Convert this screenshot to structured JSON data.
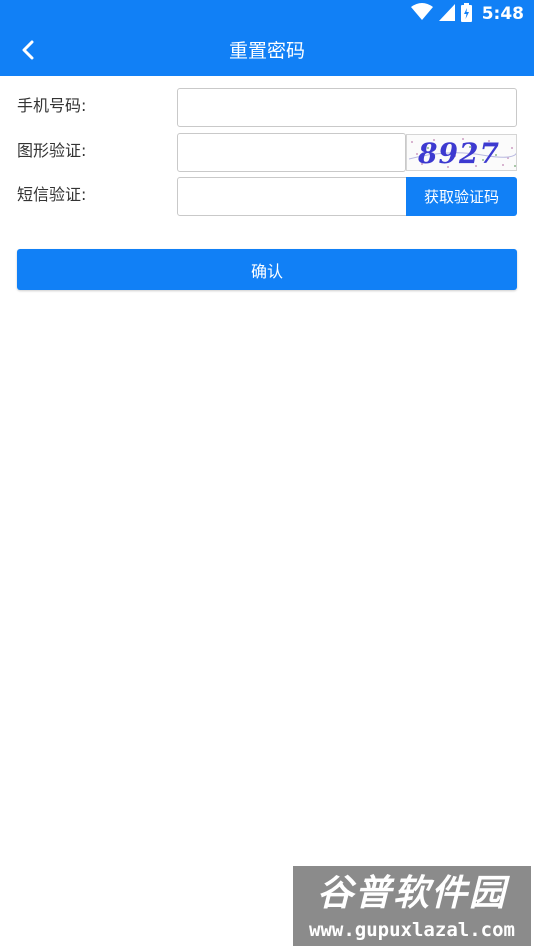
{
  "status_bar": {
    "time": "5:48",
    "icons": [
      "wifi-icon",
      "cell-signal-icon",
      "battery-icon"
    ]
  },
  "header": {
    "back_icon": "chevron-left-icon",
    "title": "重置密码"
  },
  "form": {
    "phone": {
      "label": "手机号码:",
      "value": ""
    },
    "captcha": {
      "label": "图形验证:",
      "value": "",
      "captcha_text": "8927"
    },
    "sms": {
      "label": "短信验证:",
      "value": "",
      "button_label": "获取验证码"
    }
  },
  "confirm_label": "确认",
  "watermark": {
    "text_top": "谷普软件园",
    "text_bottom": "www.gupuxlazal.com"
  },
  "colors": {
    "primary": "#1180f6",
    "background": "#ffffff",
    "label": "#333333",
    "input_border": "#c9c9c9"
  }
}
